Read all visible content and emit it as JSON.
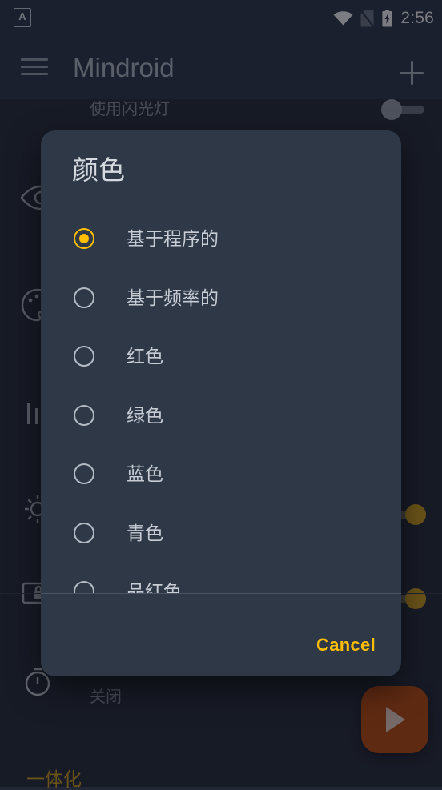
{
  "statusbar": {
    "notification_icon": "letter-a-notification-icon",
    "notification_letter": "A",
    "wifi_icon": "wifi-icon",
    "sim_icon": "no-sim-icon",
    "battery_icon": "battery-charging-icon",
    "time": "2:56"
  },
  "toolbar": {
    "menu_icon": "hamburger-menu-icon",
    "title": "Mindroid",
    "add_icon": "plus-icon"
  },
  "background": {
    "rows": [
      {
        "label": "使用闪光灯",
        "icon": "flash-icon",
        "switch": "off"
      },
      {
        "label": "",
        "icon": "eye-icon",
        "switch": ""
      },
      {
        "label": "",
        "icon": "palette-icon",
        "switch": ""
      },
      {
        "label": "",
        "icon": "equalizer-icon",
        "switch": ""
      },
      {
        "label": "",
        "icon": "brightness-icon",
        "switch": "on"
      },
      {
        "label": "",
        "icon": "screen-lock-icon",
        "switch": "on"
      },
      {
        "label": "关闭",
        "icon": "timer-icon",
        "switch": ""
      }
    ],
    "bottom_section_label": "一体化",
    "fab_icon": "play-icon"
  },
  "dialog": {
    "title": "颜色",
    "options": [
      {
        "label": "基于程序的",
        "selected": true
      },
      {
        "label": "基于频率的",
        "selected": false
      },
      {
        "label": "红色",
        "selected": false
      },
      {
        "label": "绿色",
        "selected": false
      },
      {
        "label": "蓝色",
        "selected": false
      },
      {
        "label": "青色",
        "selected": false
      },
      {
        "label": "品红色",
        "selected": false
      }
    ],
    "cancel_label": "Cancel"
  },
  "colors": {
    "accent_amber": "#ffbe00",
    "fab_orange": "#c14a0a",
    "dialog_bg": "#2e3847",
    "app_bg": "#232836",
    "toolbar_bg": "#2b3447"
  }
}
